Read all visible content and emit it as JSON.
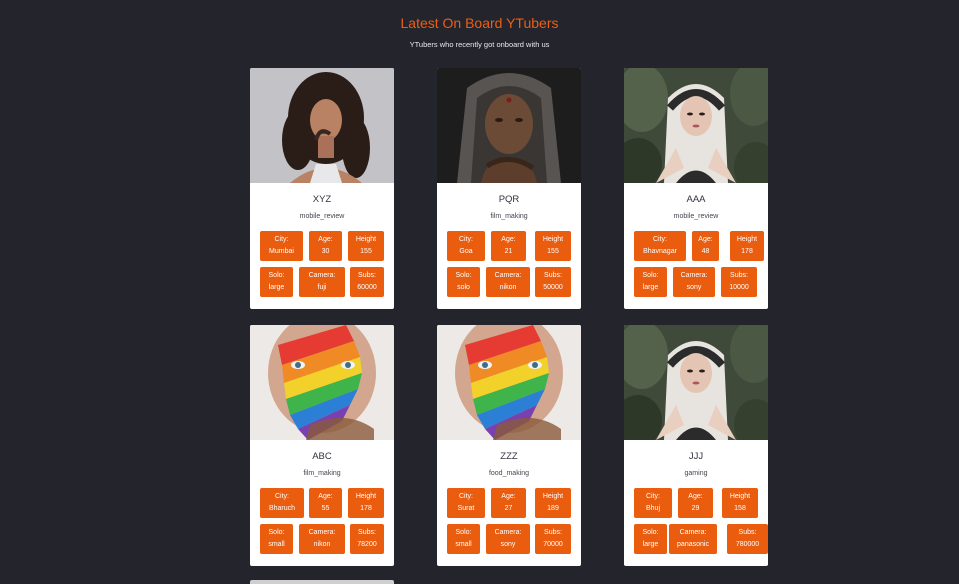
{
  "header": {
    "title": "Latest On Board YTubers",
    "subtitle": "YTubers who recently got onboard with us"
  },
  "cards": [
    {
      "name": "XYZ",
      "category": "mobile_review",
      "city_label": "City:",
      "city": "Mumbai",
      "age_label": "Age:",
      "age": "30",
      "height_label": "Height",
      "height": "155",
      "solo_label": "Solo:",
      "solo": "large",
      "camera_label": "Camera:",
      "camera": "fuji",
      "subs_label": "Subs:",
      "subs": "60000",
      "photo": "woman-curly-hair"
    },
    {
      "name": "PQR",
      "category": "film_making",
      "city_label": "City:",
      "city": "Goa",
      "age_label": "Age:",
      "age": "21",
      "height_label": "Height",
      "height": "155",
      "solo_label": "Solo:",
      "solo": "solo",
      "camera_label": "Camera:",
      "camera": "nikon",
      "subs_label": "Subs:",
      "subs": "50000",
      "photo": "elderly-woman-headscarf"
    },
    {
      "name": "AAA",
      "category": "mobile_review",
      "city_label": "City:",
      "city": "Bhavnagar",
      "age_label": "Age:",
      "age": "48",
      "height_label": "Height",
      "height": "178",
      "solo_label": "Solo:",
      "solo": "large",
      "camera_label": "Camera:",
      "camera": "sony",
      "subs_label": "Subs:",
      "subs": "10000",
      "photo": "woman-hijab-leaves"
    },
    {
      "name": "ABC",
      "category": "film_making",
      "city_label": "City:",
      "city": "Bharuch",
      "age_label": "Age:",
      "age": "55",
      "height_label": "Height",
      "height": "178",
      "solo_label": "Solo:",
      "solo": "small",
      "camera_label": "Camera:",
      "camera": "nikon",
      "subs_label": "Subs:",
      "subs": "78200",
      "photo": "man-rainbow-face"
    },
    {
      "name": "ZZZ",
      "category": "food_making",
      "city_label": "City:",
      "city": "Surat",
      "age_label": "Age:",
      "age": "27",
      "height_label": "Height",
      "height": "189",
      "solo_label": "Solo:",
      "solo": "small",
      "camera_label": "Camera:",
      "camera": "sony",
      "subs_label": "Subs:",
      "subs": "70000",
      "photo": "man-rainbow-face"
    },
    {
      "name": "JJJ",
      "category": "gaming",
      "city_label": "City:",
      "city": "Bhuj",
      "age_label": "Age:",
      "age": "29",
      "height_label": "Height",
      "height": "158",
      "solo_label": "Solo:",
      "solo": "large",
      "camera_label": "Camera:",
      "camera": "panasonic",
      "subs_label": "Subs:",
      "subs": "780000",
      "photo": "woman-hijab-leaves"
    }
  ],
  "colors": {
    "background": "#24242c",
    "accent": "#ea5c0e",
    "title": "#ec5f14",
    "card": "#ffffff"
  }
}
